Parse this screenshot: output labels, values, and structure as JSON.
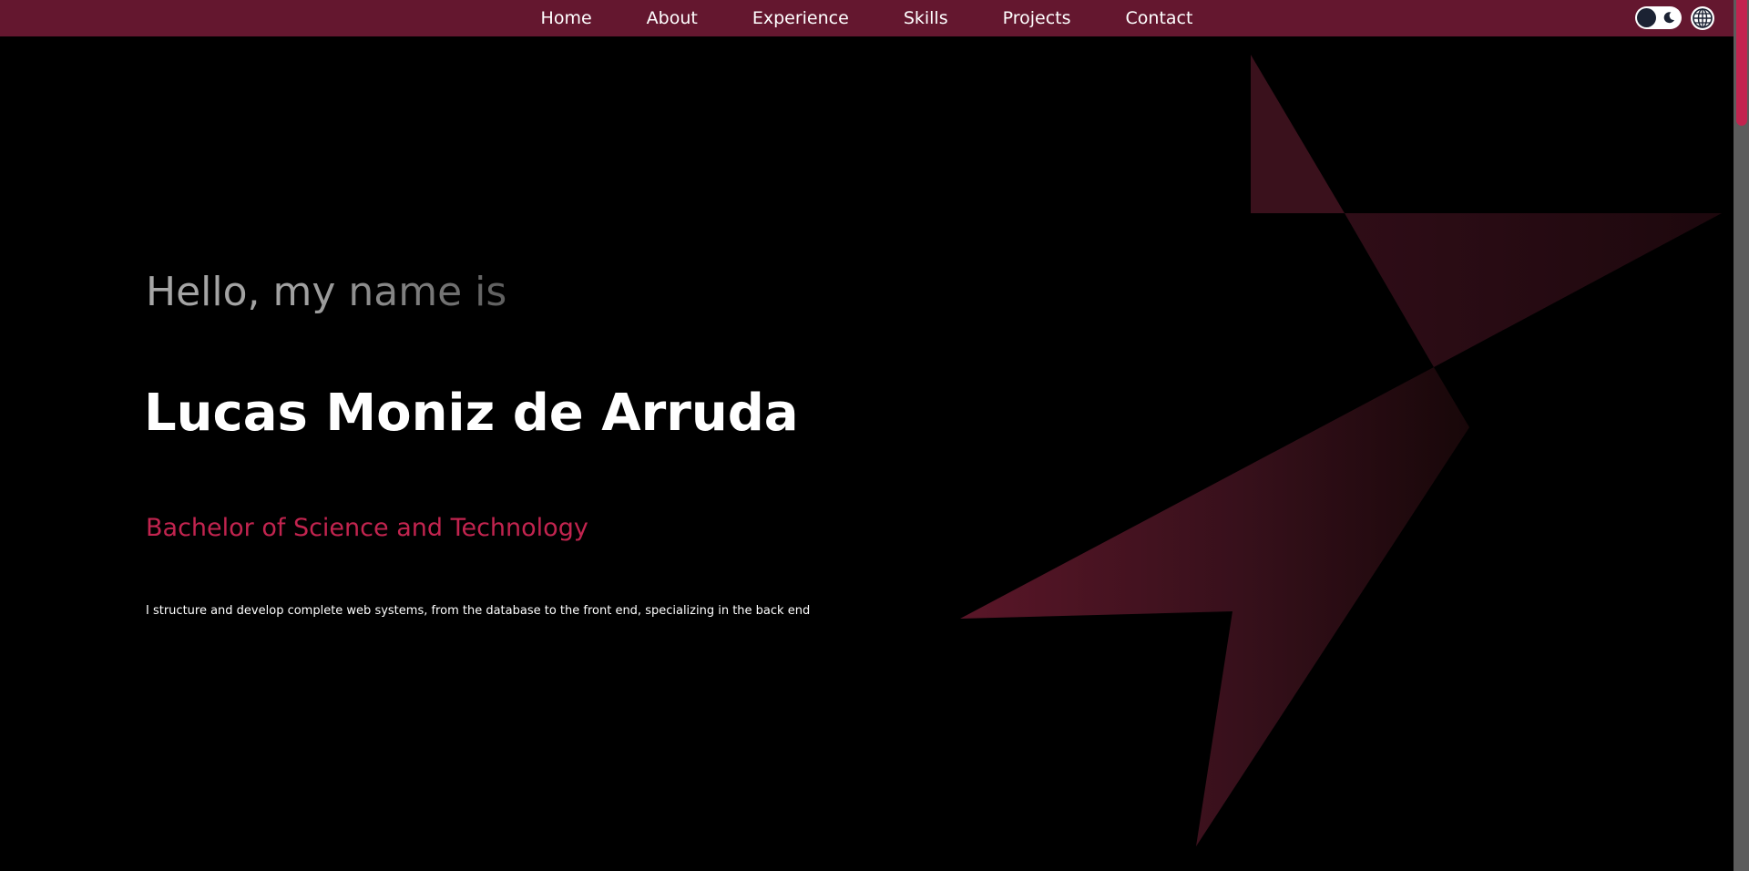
{
  "nav": {
    "items": [
      {
        "label": "Home"
      },
      {
        "label": "About"
      },
      {
        "label": "Experience"
      },
      {
        "label": "Skills"
      },
      {
        "label": "Projects"
      },
      {
        "label": "Contact"
      }
    ]
  },
  "controls": {
    "theme_toggle_icon": "moon-icon",
    "language_icon": "globe-icon"
  },
  "hero": {
    "greeting": "Hello, my name is",
    "name": "Lucas Moniz de Arruda",
    "degree": "Bachelor of Science and Technology",
    "description": "I structure and develop complete web systems, from the database to the front end, specializing in the back end"
  },
  "colors": {
    "navbar": "#64172f",
    "accent": "#c2244f",
    "background": "#000000",
    "text": "#ffffff"
  }
}
